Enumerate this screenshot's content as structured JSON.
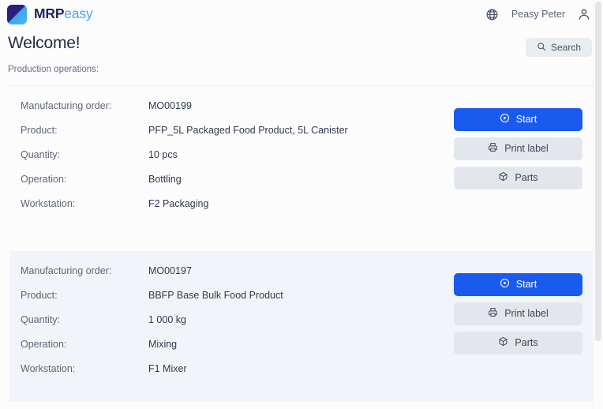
{
  "topbar": {
    "brand_primary": "MRP",
    "brand_secondary": "easy",
    "language_icon": "globe-icon",
    "user_name": "Peasy Peter",
    "account_icon": "user-icon"
  },
  "header": {
    "title": "Welcome!",
    "search_label": "Search",
    "search_icon": "search-icon",
    "section_label": "Production operations:"
  },
  "field_labels": {
    "manufacturing_order": "Manufacturing order:",
    "product": "Product:",
    "quantity": "Quantity:",
    "operation": "Operation:",
    "workstation": "Workstation:"
  },
  "actions": {
    "start": "Start",
    "start_icon": "play-circle-icon",
    "print_label": "Print label",
    "print_icon": "printer-icon",
    "parts": "Parts",
    "parts_icon": "cube-icon"
  },
  "colors": {
    "primary_button": "#1a5bef",
    "secondary_button": "#e3e7ed",
    "alt_card_background": "#f1f5f9",
    "brand_blue": "#4aa3e8"
  },
  "operations": [
    {
      "manufacturing_order": "MO00199",
      "product": "PFP_5L Packaged Food Product, 5L Canister",
      "quantity": "10 pcs",
      "operation": "Bottling",
      "workstation": "F2 Packaging"
    },
    {
      "manufacturing_order": "MO00197",
      "product": "BBFP Base Bulk Food Product",
      "quantity": "1 000 kg",
      "operation": "Mixing",
      "workstation": "F1 Mixer"
    }
  ]
}
